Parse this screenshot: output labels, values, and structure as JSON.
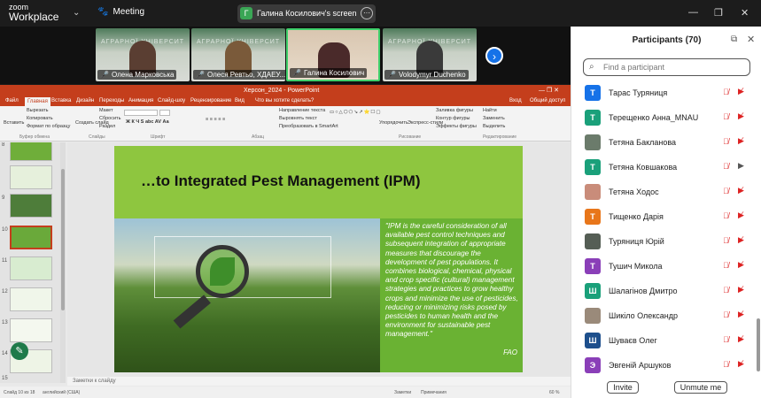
{
  "app": {
    "logo_line1": "zoom",
    "logo_line2": "Workplace",
    "meeting_label": "Meeting"
  },
  "share": {
    "avatar_letter": "Г",
    "label": "Галина Косилович's screen"
  },
  "gallery": {
    "tiles": [
      {
        "name": "Олена Марковська",
        "bg": "АГРАРНОЇ УНІВЕРСИТ"
      },
      {
        "name": "Олеся Ревтьо, ХДАЕУ...",
        "bg": "АГРАРНОЇ УНІВЕРСИТ"
      },
      {
        "name": "Галина Косилович",
        "bg": ""
      },
      {
        "name": "Volodymyr Duchenko",
        "bg": "АГРАРНОЇ УНІВЕРСИТ"
      }
    ]
  },
  "ppt": {
    "window_title": "Херсон_2024 - PowerPoint",
    "tabs": [
      "Файл",
      "Главная",
      "Вставка",
      "Дизайн",
      "Переходы",
      "Анимация",
      "Слайд-шоу",
      "Рецензирование",
      "Вид",
      "Что вы хотите сделать?",
      "Вход",
      "Общий доступ"
    ],
    "ribbon": {
      "paste": "Вставить",
      "cut": "Вырезать",
      "copy": "Копировать",
      "format": "Формат по образцу",
      "clipboard": "Буфер обмена",
      "new_slide": "Создать слайд",
      "layout": "Макет",
      "reset": "Сбросить",
      "section": "Раздел",
      "slides": "Слайды",
      "font": "Шрифт",
      "paragraph": "Абзац",
      "text_dir": "Направление текста",
      "align_text": "Выровнять текст",
      "smartart": "Преобразовать в SmartArt",
      "arrange": "Упорядочить",
      "quick_styles": "Экспресс-стили",
      "drawing": "Рисование",
      "shape_fill": "Заливка фигуры",
      "shape_outline": "Контур фигуры",
      "shape_effects": "Эффекты фигуры",
      "find": "Найти",
      "replace": "Заменить",
      "select": "Выделить",
      "editing": "Редактирование"
    },
    "slide_numbers": [
      "8",
      "9",
      "10",
      "11",
      "12",
      "13",
      "14",
      "15"
    ],
    "slide": {
      "title": "…to Integrated Pest Management (IPM)",
      "quote": "\"IPM is the careful consideration of all available pest control techniques and subsequent integration of appropriate measures that discourage the development of pest populations. It combines biological, chemical, physical and crop specific (cultural) management strategies and practices to grow healthy crops and minimize the use of pesticides, reducing or minimizing risks posed by pesticides to human health and the environment for sustainable pest management.\"",
      "attribution": "FAO"
    },
    "notes_placeholder": "Заметки к слайду",
    "status": {
      "slide_of": "Слайд 10 из 18",
      "lang": "английский (США)",
      "notes": "Заметки",
      "comments": "Примечания",
      "zoom": "60 %"
    }
  },
  "panel": {
    "title": "Participants (70)",
    "search_placeholder": "Find a participant",
    "participants": [
      {
        "letter": "Т",
        "name": "Тарас Туряниця",
        "color": "#1672e8",
        "cam_on": false
      },
      {
        "letter": "Т",
        "name": "Терещенко Анна_MNAU",
        "color": "#1aa07a",
        "cam_on": false
      },
      {
        "letter": "",
        "name": "Тетяна Бакланова",
        "color": "#6b7b6b",
        "cam_on": false
      },
      {
        "letter": "Т",
        "name": "Тетяна Ковшакова",
        "color": "#1aa07a",
        "cam_on": true
      },
      {
        "letter": "",
        "name": "Тетяна Ходос",
        "color": "#c98c7a",
        "cam_on": false
      },
      {
        "letter": "Т",
        "name": "Тищенко Дарія",
        "color": "#e8761a",
        "cam_on": false
      },
      {
        "letter": "",
        "name": "Туряниця Юрій",
        "color": "#555e55",
        "cam_on": false
      },
      {
        "letter": "Т",
        "name": "Тушич Микола",
        "color": "#8a3fb8",
        "cam_on": false
      },
      {
        "letter": "Ш",
        "name": "Шалагінов Дмитро",
        "color": "#1aa07a",
        "cam_on": false
      },
      {
        "letter": "",
        "name": "Шикіло Олександр",
        "color": "#9a8a7a",
        "cam_on": false
      },
      {
        "letter": "Ш",
        "name": "Шуваєв Олег",
        "color": "#1d4f8c",
        "cam_on": false
      },
      {
        "letter": "Э",
        "name": "Эвгеній Аршуков",
        "color": "#8a3fb8",
        "cam_on": false
      }
    ],
    "invite_label": "Invite",
    "unmute_label": "Unmute me"
  }
}
